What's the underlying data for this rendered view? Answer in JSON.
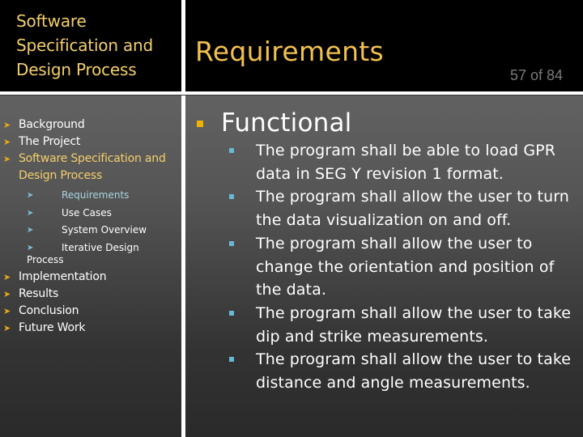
{
  "section_title": "Software Specification and Design Process",
  "slide_title": "Requirements",
  "page_indicator": "57 of 84",
  "colors": {
    "accent_gold": "#f2c14e",
    "bullet_gold": "#f0b400",
    "bullet_blue": "#6ab7d6",
    "header_bg": "#000000"
  },
  "nav": {
    "items": [
      {
        "label": "Background"
      },
      {
        "label": "The Project"
      },
      {
        "label": "Software Specification and Design Process",
        "active": true,
        "subitems": [
          {
            "label": "Requirements",
            "current": true
          },
          {
            "label": "Use Cases"
          },
          {
            "label": "System Overview"
          },
          {
            "label": "Iterative Design"
          }
        ],
        "sub_tail": "Process"
      },
      {
        "label": "Implementation"
      },
      {
        "label": "Results"
      },
      {
        "label": "Conclusion"
      },
      {
        "label": "Future Work"
      }
    ],
    "bullet_icon": "arrow-bullet-icon"
  },
  "content": {
    "heading": "Functional",
    "items": [
      "The program shall be able to load GPR data in SEG Y revision 1 format.",
      "The program shall allow the user to turn the data visualization on and off.",
      "The program shall allow the user to change the orientation and position of the data.",
      "The program shall allow the user to take dip and strike measurements.",
      "The program shall allow the user to take distance and angle measurements."
    ]
  }
}
